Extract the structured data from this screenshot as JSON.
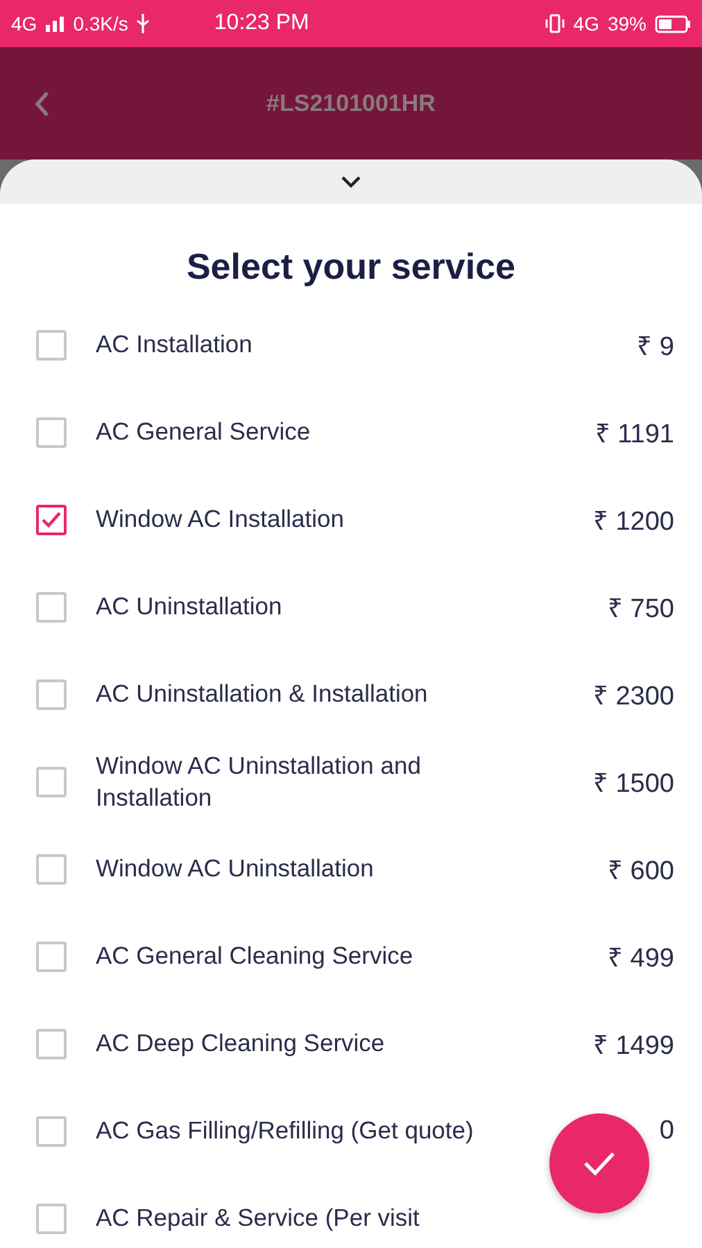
{
  "status_bar": {
    "network": "4G",
    "speed": "0.3K/s",
    "time": "10:23 PM",
    "network_right": "4G",
    "battery": "39%"
  },
  "header": {
    "title": "#LS2101001HR"
  },
  "sheet": {
    "title": "Select your service",
    "services": [
      {
        "label": "AC Installation",
        "price": "₹ 9",
        "checked": false
      },
      {
        "label": "AC General Service",
        "price": "₹ 1191",
        "checked": false
      },
      {
        "label": "Window AC Installation",
        "price": "₹ 1200",
        "checked": true
      },
      {
        "label": "AC Uninstallation",
        "price": "₹ 750",
        "checked": false
      },
      {
        "label": "AC Uninstallation & Installation",
        "price": "₹ 2300",
        "checked": false
      },
      {
        "label": "Window AC Uninstallation and Installation",
        "price": "₹ 1500",
        "checked": false
      },
      {
        "label": "Window AC Uninstallation",
        "price": "₹ 600",
        "checked": false
      },
      {
        "label": "AC General Cleaning Service",
        "price": "₹ 499",
        "checked": false
      },
      {
        "label": "AC Deep Cleaning Service",
        "price": "₹ 1499",
        "checked": false
      },
      {
        "label": "AC Gas Filling/Refilling (Get quote)",
        "price": "0",
        "checked": false
      },
      {
        "label": "AC Repair & Service (Per visit",
        "checked": false
      }
    ]
  }
}
